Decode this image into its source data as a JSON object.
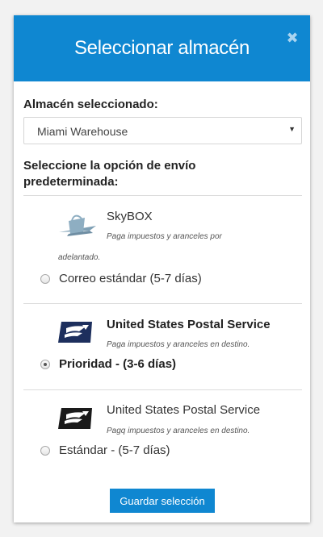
{
  "modal": {
    "title": "Seleccionar almacén",
    "close_icon": "close-icon"
  },
  "warehouse": {
    "label": "Almacén seleccionado:",
    "selected": "Miami Warehouse"
  },
  "shipping": {
    "label": "Seleccione la opción de envío predeterminada:",
    "options": [
      {
        "carrier": "SkyBOX",
        "note_line1": "Paga impuestos y aranceles por",
        "note_line2": "adelantado.",
        "service": "Correo estándar (5-7 días)",
        "selected": false,
        "logo": "skybox-logo-icon"
      },
      {
        "carrier": "United States Postal Service",
        "note_line1": "Paga impuestos y aranceles en destino.",
        "service": "Prioridad - (3-6 días)",
        "selected": true,
        "logo": "usps-eagle-icon"
      },
      {
        "carrier": "United States Postal Service",
        "note_line1": "Pagq impuestos y aranceles en destino.",
        "service": "Estándar - (5-7 días)",
        "selected": false,
        "logo": "usps-eagle-icon"
      }
    ]
  },
  "actions": {
    "save_label": "Guardar selección"
  },
  "colors": {
    "header": "#0f87d1",
    "button": "#0f87d1"
  }
}
